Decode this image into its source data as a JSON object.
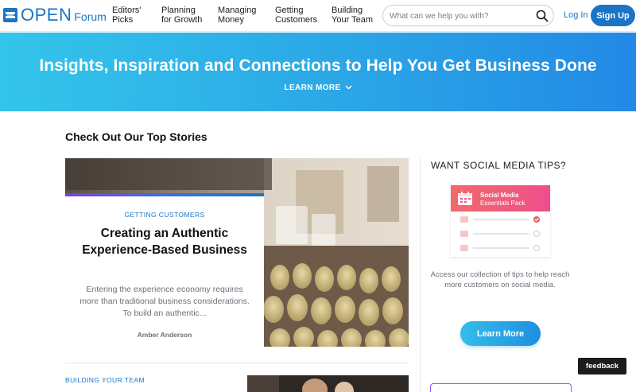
{
  "brand": {
    "logo_icon": "amex-logo-icon",
    "open": "OPEN",
    "forum": "Forum",
    "color": "#1b74c4"
  },
  "nav": {
    "items": [
      {
        "line1": "Editors'",
        "line2": "Picks"
      },
      {
        "line1": "Planning",
        "line2": "for Growth"
      },
      {
        "line1": "Managing",
        "line2": "Money"
      },
      {
        "line1": "Getting",
        "line2": "Customers"
      },
      {
        "line1": "Building",
        "line2": "Your Team"
      }
    ]
  },
  "search": {
    "placeholder": "What can we help you with?",
    "icon": "search-icon"
  },
  "auth": {
    "login": "Log In",
    "signup": "Sign Up"
  },
  "hero": {
    "title": "Insights, Inspiration and Connections to Help You Get Business Done",
    "learn_more": "LEARN MORE",
    "icon": "chevron-down-icon"
  },
  "main": {
    "section_title": "Check Out Our Top Stories",
    "featured_story": {
      "category": "GETTING CUSTOMERS",
      "title": "Creating an Authentic Experience-Based Business",
      "excerpt": "Entering the experience economy requires more than traditional business considerations. To build an authentic...",
      "author": "Amber Anderson"
    },
    "next_story": {
      "category": "BUILDING YOUR TEAM"
    }
  },
  "sidebar": {
    "title": "WANT SOCIAL MEDIA TIPS?",
    "promo": {
      "line1": "Social Media",
      "line2": "Essentials Pack",
      "icon": "calendar-icon"
    },
    "text": "Access our collection of tips to help reach more customers on social media.",
    "button": "Learn More"
  },
  "feedback": "feedback",
  "colors": {
    "accent": "#1b74c4",
    "hero_start": "#34c5ea",
    "hero_end": "#2289e6",
    "promo_start": "#f06a6a",
    "promo_end": "#ef4e8c"
  }
}
